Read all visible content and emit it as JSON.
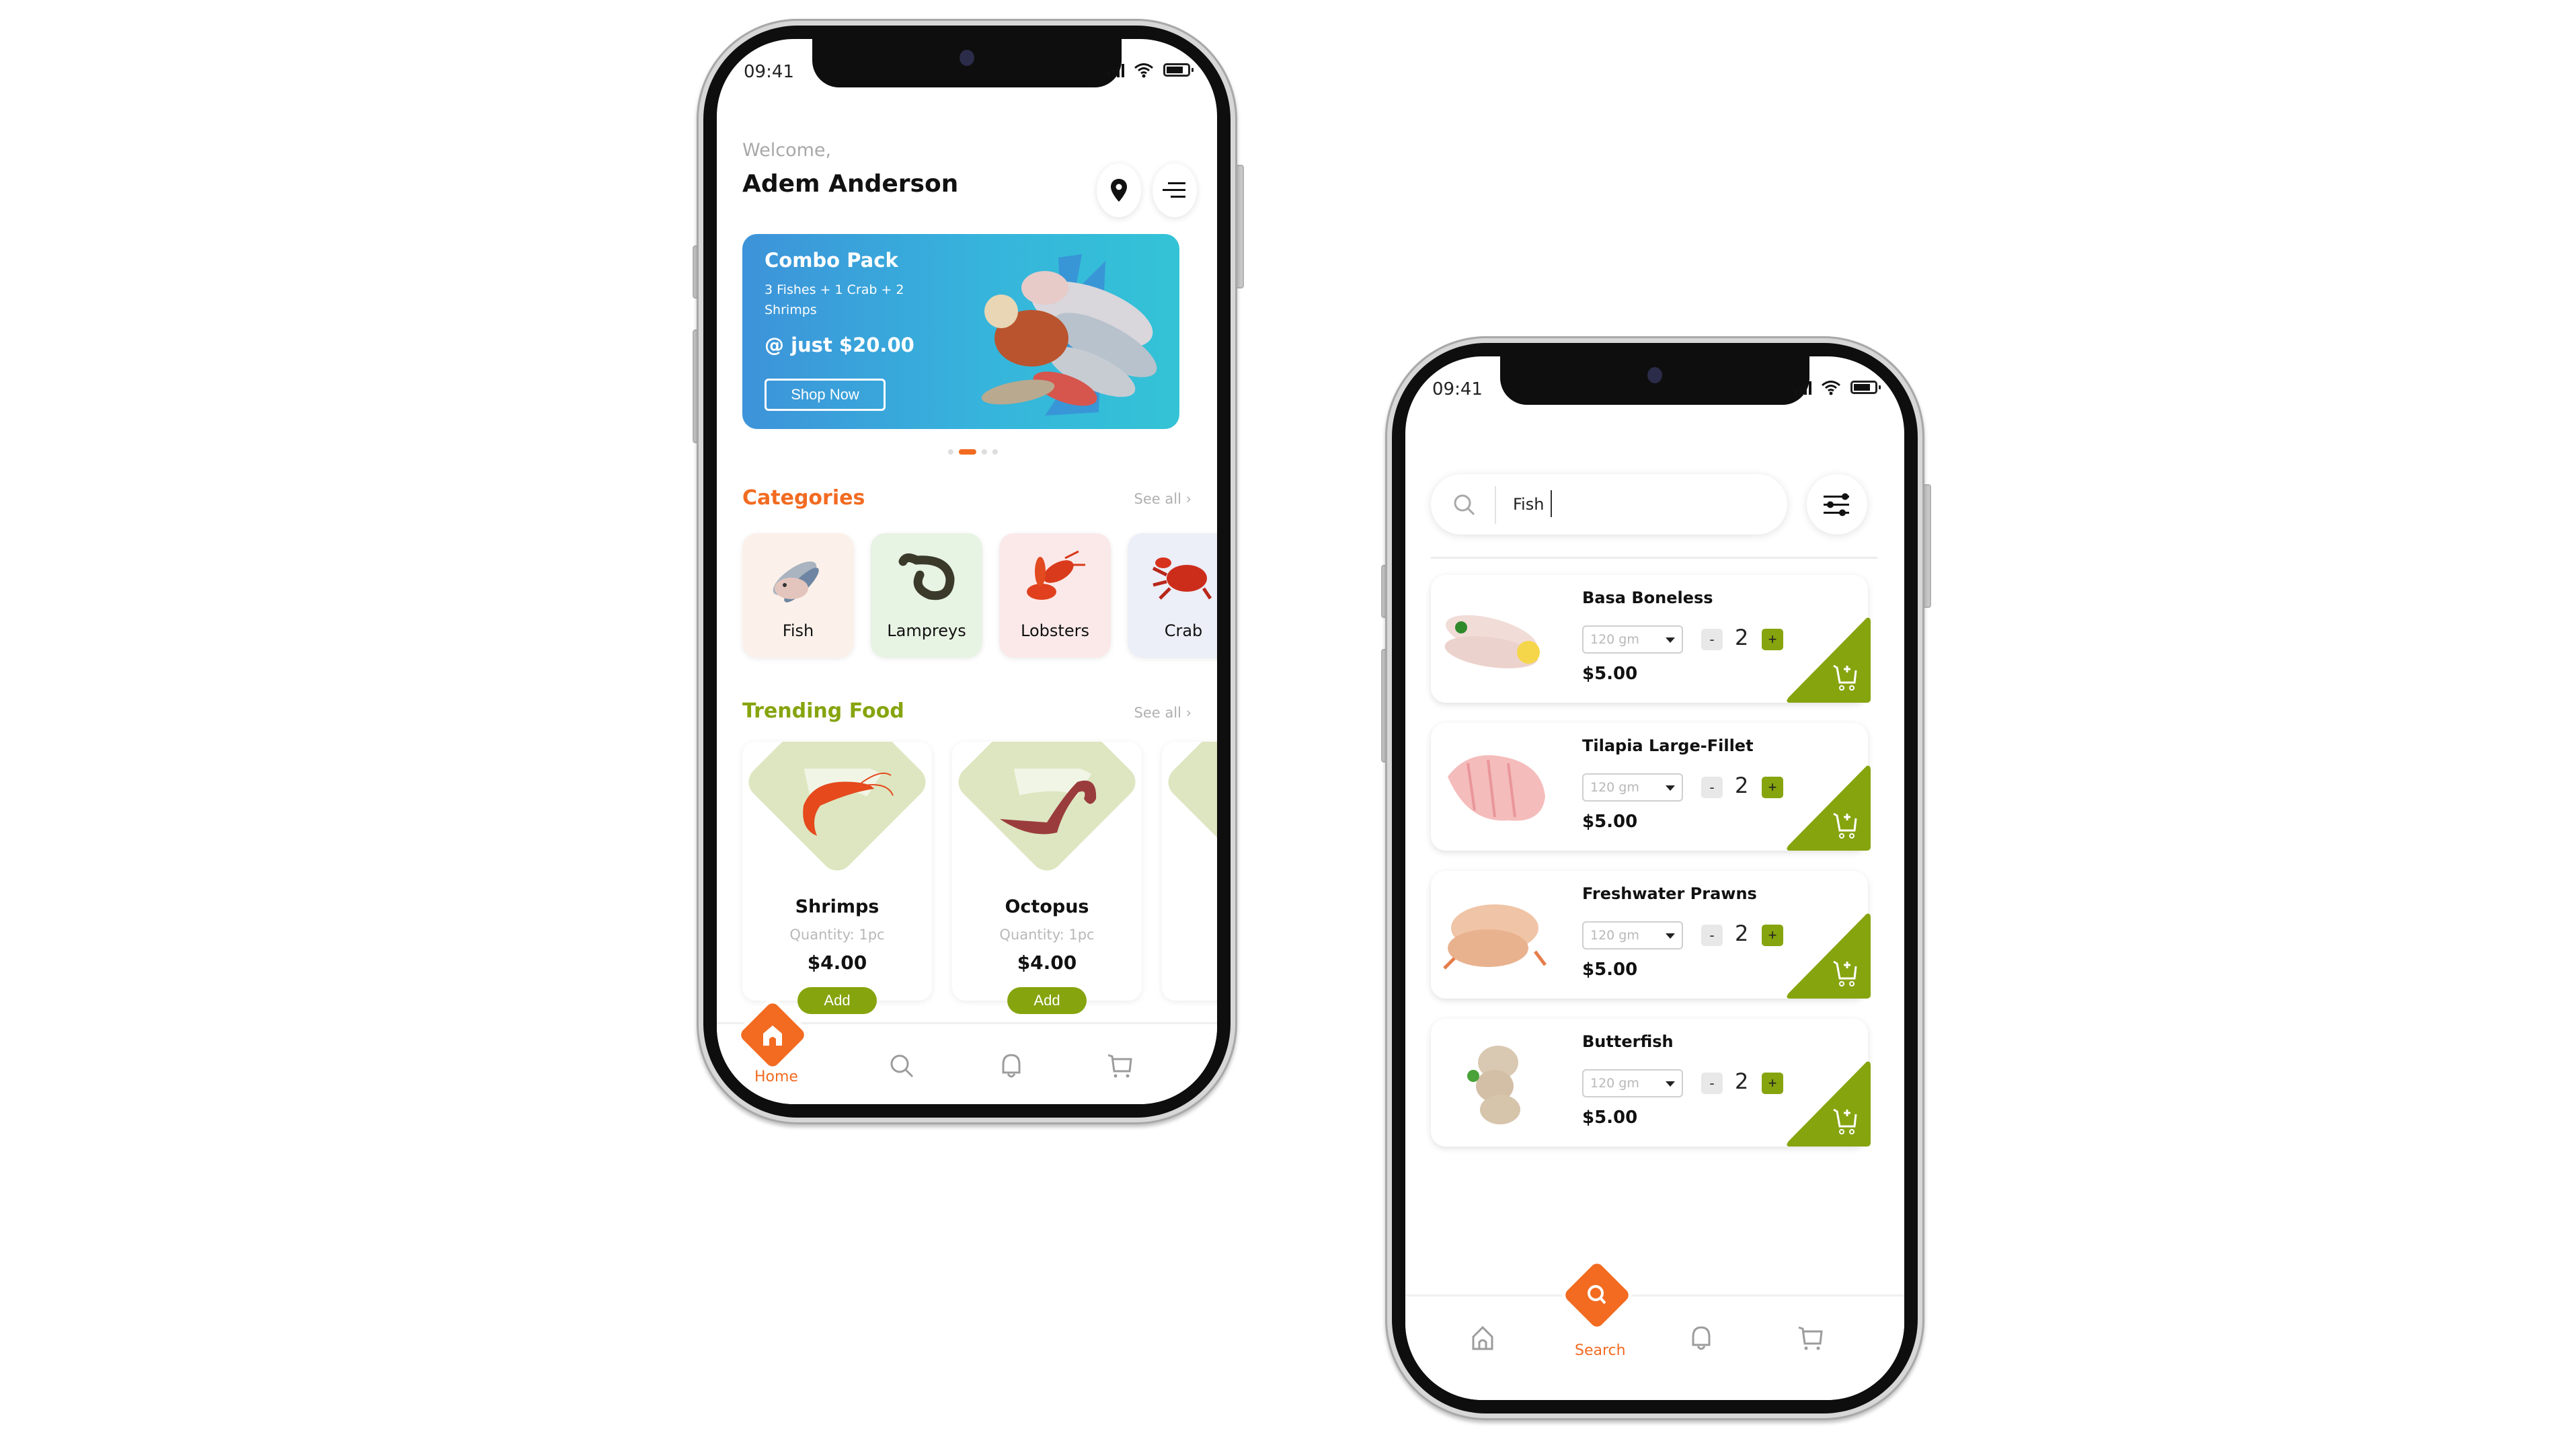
{
  "colors": {
    "accent_orange": "#f26b21",
    "accent_green": "#86a40e",
    "banner_start": "#3d93d9",
    "banner_end": "#33c3d6",
    "muted_text": "#b0b0b0"
  },
  "home_screen": {
    "status_bar": {
      "time": "09:41",
      "icons": [
        "signal-icon",
        "wifi-icon",
        "battery-icon"
      ]
    },
    "header": {
      "greeting": "Welcome,",
      "user_name": "Adem Anderson",
      "buttons": [
        {
          "icon": "location-pin-icon"
        },
        {
          "icon": "menu-icon"
        }
      ]
    },
    "banner": {
      "title": "Combo Pack",
      "description": "3 Fishes + 1 Crab + 2 Shrimps",
      "price": "@ just $20.00",
      "cta_label": "Shop Now",
      "carousel": {
        "total": 4,
        "active_index": 1
      }
    },
    "categories": {
      "title": "Categories",
      "see_all": "See all ›",
      "items": [
        {
          "label": "Fish",
          "icon": "fish-icon",
          "bg": "#fcf1ea"
        },
        {
          "label": "Lampreys",
          "icon": "lamprey-icon",
          "bg": "#e7f3e3"
        },
        {
          "label": "Lobsters",
          "icon": "lobster-icon",
          "bg": "#fbe9e9"
        },
        {
          "label": "Crab",
          "icon": "crab-icon",
          "bg": "#eceef8"
        }
      ]
    },
    "trending": {
      "title": "Trending Food",
      "see_all": "See all ›",
      "items": [
        {
          "name": "Shrimps",
          "quantity": "Quantity: 1pc",
          "price": "$4.00",
          "add_label": "Add",
          "icon": "shrimp-icon"
        },
        {
          "name": "Octopus",
          "quantity": "Quantity: 1pc",
          "price": "$4.00",
          "add_label": "Add",
          "icon": "octopus-icon"
        }
      ]
    },
    "tab_bar": {
      "active": "Home",
      "tabs": [
        {
          "label": "Home",
          "icon": "home-icon"
        },
        {
          "label": "Search",
          "icon": "search-icon"
        },
        {
          "label": "Notifications",
          "icon": "bell-icon"
        },
        {
          "label": "Cart",
          "icon": "cart-icon"
        }
      ]
    }
  },
  "search_screen": {
    "status_bar": {
      "time": "09:41"
    },
    "search": {
      "value": "Fish",
      "icon": "search-icon",
      "filter_icon": "sliders-icon"
    },
    "results": [
      {
        "name": "Basa Boneless",
        "weight": "120 gm",
        "quantity": "2",
        "price": "$5.00",
        "minus": "-",
        "plus": "+"
      },
      {
        "name": "Tilapia Large-Fillet",
        "weight": "120 gm",
        "quantity": "2",
        "price": "$5.00",
        "minus": "-",
        "plus": "+"
      },
      {
        "name": "Freshwater Prawns",
        "weight": "120 gm",
        "quantity": "2",
        "price": "$5.00",
        "minus": "-",
        "plus": "+"
      },
      {
        "name": "Butterfish",
        "weight": "120 gm",
        "quantity": "2",
        "price": "$5.00",
        "minus": "-",
        "plus": "+"
      }
    ],
    "tab_bar": {
      "active": "Search",
      "active_label": "Search"
    }
  }
}
